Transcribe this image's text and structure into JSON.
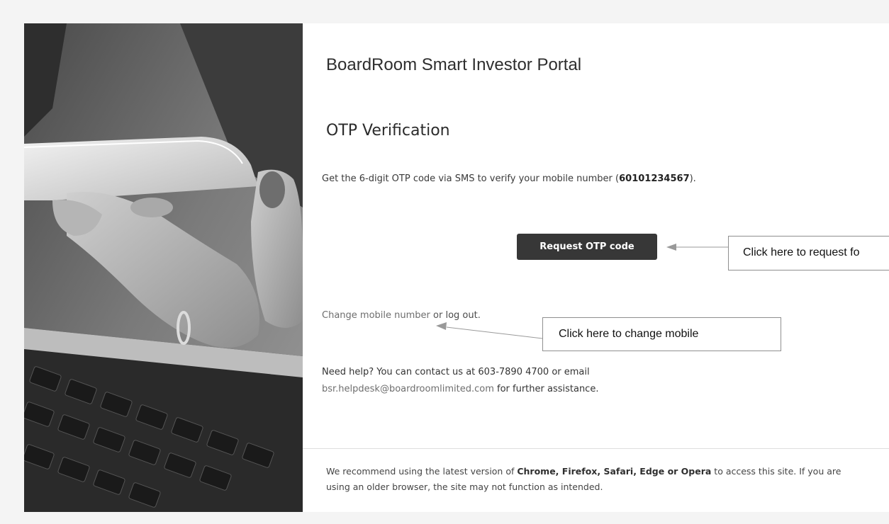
{
  "portal": {
    "title": "BoardRoom Smart Investor Portal"
  },
  "otp": {
    "heading": "OTP Verification",
    "description_prefix": "Get the 6-digit OTP code via SMS to verify your mobile number (",
    "mobile_number": "60101234567",
    "description_suffix": ").",
    "request_button_label": "Request OTP code"
  },
  "links": {
    "change_mobile": "Change mobile number",
    "or_text": " or ",
    "log_out": "log out",
    "period": "."
  },
  "help": {
    "line1": "Need help? You can contact us at 603-7890 4700 or email",
    "email": "bsr.helpdesk@boardroomlimited.com",
    "line2_suffix": " for further assistance."
  },
  "footer": {
    "prefix": "We recommend using the latest version of ",
    "browsers": "Chrome, Firefox, Safari, Edge or Opera",
    "suffix": " to access this site. If you are using an older browser, the site may not function as intended."
  },
  "annotations": {
    "request_callout": "Click here to request fo",
    "change_mobile_callout": "Click here to change mobile"
  },
  "hero": {
    "image": "phone-and-laptop-photo"
  },
  "colors": {
    "button_bg": "#373737",
    "page_bg": "#f4f4f4",
    "link_gray": "#6e6e6e"
  }
}
